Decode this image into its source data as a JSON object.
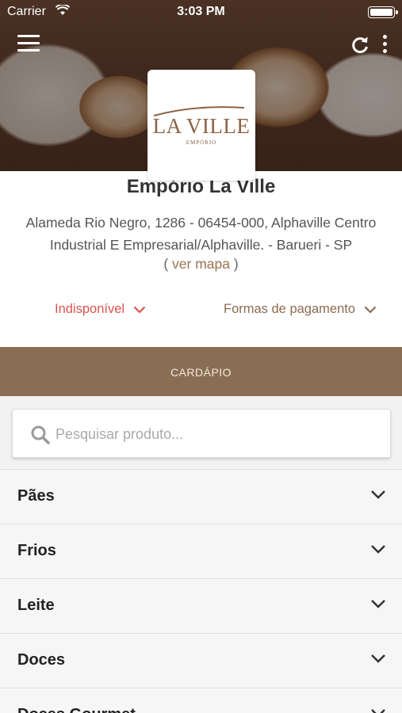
{
  "status_bar": {
    "carrier": "Carrier",
    "time": "3:03 PM"
  },
  "store": {
    "logo_text": "LA VILLE",
    "logo_subtext": "EMPÓRIO",
    "name": "Empório La Ville",
    "address": "Alameda Rio Negro, 1286 - 06454-000, Alphaville Centro Industrial E Empresarial/Alphaville. - Barueri - SP",
    "map_open": "(",
    "map_link": "ver mapa",
    "map_close": ")"
  },
  "toggles": {
    "status": "Indisponível",
    "payment": "Formas de pagamento"
  },
  "tabs": {
    "menu": "CARDÁPIO"
  },
  "search": {
    "placeholder": "Pesquisar produto..."
  },
  "categories": [
    {
      "label": "Pães"
    },
    {
      "label": "Frios"
    },
    {
      "label": "Leite"
    },
    {
      "label": "Doces"
    },
    {
      "label": "Doces Gourmet"
    }
  ],
  "colors": {
    "accent": "#8a6e53",
    "unavailable": "#d9534f",
    "link": "#9a7352"
  },
  "icons": [
    "menu-icon",
    "refresh-icon",
    "more-vert-icon",
    "search-icon",
    "chevron-down-icon",
    "wifi-icon",
    "battery-icon"
  ]
}
